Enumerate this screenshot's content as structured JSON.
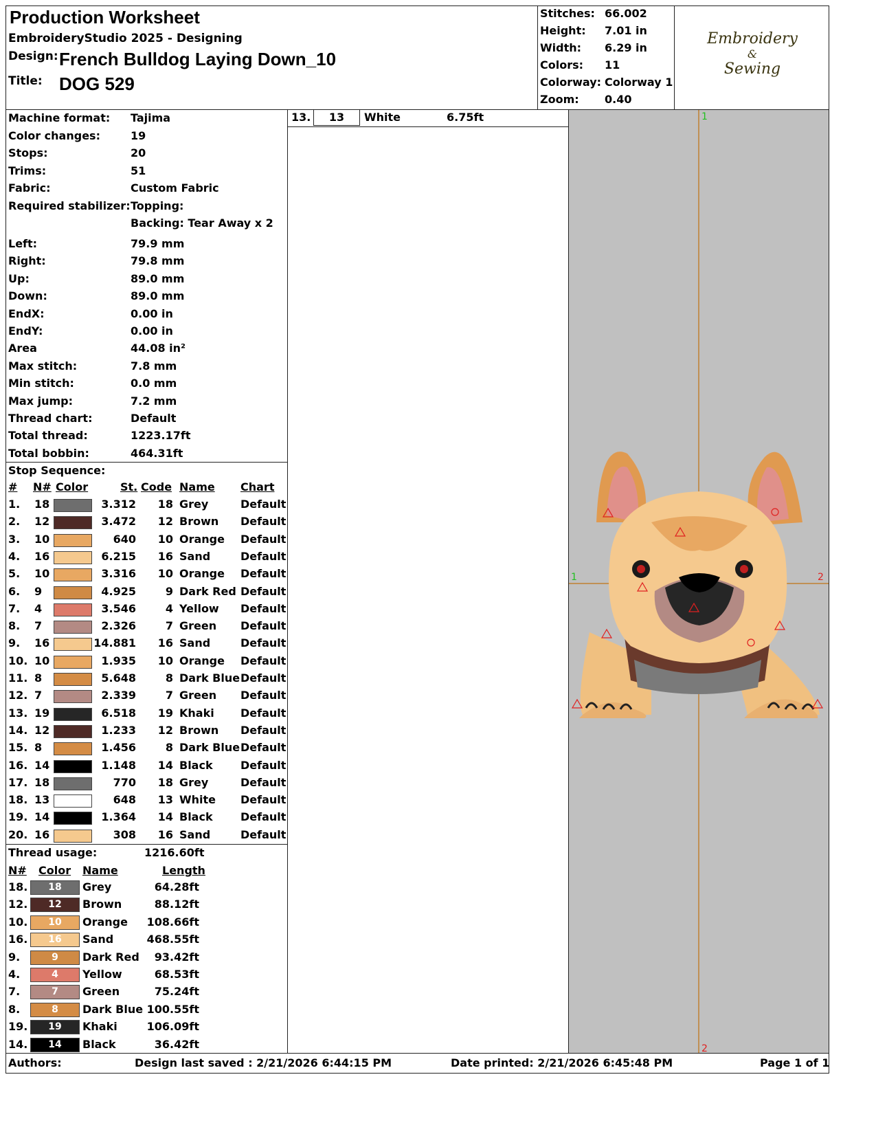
{
  "header": {
    "title": "Production Worksheet",
    "software": "EmbroideryStudio 2025 - Designing",
    "design_label": "Design:",
    "design_value": "French Bulldog Laying Down_10",
    "title_label": "Title:",
    "title_value": "DOG 529"
  },
  "summary": [
    {
      "label": "Stitches:",
      "value": "66.002"
    },
    {
      "label": "Height:",
      "value": "7.01 in"
    },
    {
      "label": "Width:",
      "value": "6.29 in"
    },
    {
      "label": "Colors:",
      "value": "11"
    },
    {
      "label": "Colorway:",
      "value": "Colorway 1"
    },
    {
      "label": "Zoom:",
      "value": "0.40"
    }
  ],
  "logo": {
    "line1": "Embroidery",
    "line2": "&",
    "line3": "Sewing"
  },
  "details": [
    {
      "label": "Machine format:",
      "value": "Tajima"
    },
    {
      "label": "Color changes:",
      "value": "19"
    },
    {
      "label": "Stops:",
      "value": "20"
    },
    {
      "label": "Trims:",
      "value": "51"
    },
    {
      "label": "Fabric:",
      "value": "Custom Fabric"
    },
    {
      "label": "Required stabilizer:",
      "value": "Topping:"
    },
    {
      "label": "",
      "value": "Backing: Tear Away x 2"
    }
  ],
  "extents": [
    {
      "label": "Left:",
      "value": "79.9 mm"
    },
    {
      "label": "Right:",
      "value": "79.8 mm"
    },
    {
      "label": "Up:",
      "value": "89.0 mm"
    },
    {
      "label": "Down:",
      "value": "89.0 mm"
    },
    {
      "label": "EndX:",
      "value": "0.00 in"
    },
    {
      "label": "EndY:",
      "value": "0.00 in"
    },
    {
      "label": "Area",
      "value": " 44.08 in²"
    },
    {
      "label": "Max stitch:",
      "value": "7.8 mm"
    },
    {
      "label": "Min stitch:",
      "value": "0.0 mm"
    },
    {
      "label": "Max jump:",
      "value": "7.2 mm"
    },
    {
      "label": "Thread chart:",
      "value": "Default"
    },
    {
      "label": "Total thread:",
      "value": "1223.17ft"
    },
    {
      "label": "Total bobbin:",
      "value": "464.31ft"
    }
  ],
  "stop_sequence": {
    "title": "Stop Sequence:",
    "headers": {
      "num": "#",
      "n": "N#",
      "color": "Color",
      "st": "St.",
      "code": "Code",
      "name": "Name",
      "chart": "Chart"
    },
    "rows": [
      {
        "num": "1.",
        "n": "18",
        "color": "#6e6e6e",
        "st": "3.312",
        "code": "18",
        "name": "Grey",
        "chart": "Default"
      },
      {
        "num": "2.",
        "n": "12",
        "color": "#4e2a26",
        "st": "3.472",
        "code": "12",
        "name": "Brown",
        "chart": "Default"
      },
      {
        "num": "3.",
        "n": "10",
        "color": "#e8a862",
        "st": "640",
        "code": "10",
        "name": "Orange",
        "chart": "Default"
      },
      {
        "num": "4.",
        "n": "16",
        "color": "#f5c98e",
        "st": "6.215",
        "code": "16",
        "name": "Sand",
        "chart": "Default"
      },
      {
        "num": "5.",
        "n": "10",
        "color": "#e8a862",
        "st": "3.316",
        "code": "10",
        "name": "Orange",
        "chart": "Default"
      },
      {
        "num": "6.",
        "n": "9",
        "color": "#cf8a45",
        "st": "4.925",
        "code": "9",
        "name": "Dark Red",
        "chart": "Default"
      },
      {
        "num": "7.",
        "n": "4",
        "color": "#dd7a6a",
        "st": "3.546",
        "code": "4",
        "name": "Yellow",
        "chart": "Default"
      },
      {
        "num": "8.",
        "n": "7",
        "color": "#b38a84",
        "st": "2.326",
        "code": "7",
        "name": "Green",
        "chart": "Default"
      },
      {
        "num": "9.",
        "n": "16",
        "color": "#f5c98e",
        "st": "14.881",
        "code": "16",
        "name": "Sand",
        "chart": "Default"
      },
      {
        "num": "10.",
        "n": "10",
        "color": "#e8a862",
        "st": "1.935",
        "code": "10",
        "name": "Orange",
        "chart": "Default"
      },
      {
        "num": "11.",
        "n": "8",
        "color": "#d48c45",
        "st": "5.648",
        "code": "8",
        "name": "Dark Blue",
        "chart": "Default"
      },
      {
        "num": "12.",
        "n": "7",
        "color": "#b38a84",
        "st": "2.339",
        "code": "7",
        "name": "Green",
        "chart": "Default"
      },
      {
        "num": "13.",
        "n": "19",
        "color": "#262626",
        "st": "6.518",
        "code": "19",
        "name": "Khaki",
        "chart": "Default"
      },
      {
        "num": "14.",
        "n": "12",
        "color": "#4e2a26",
        "st": "1.233",
        "code": "12",
        "name": "Brown",
        "chart": "Default"
      },
      {
        "num": "15.",
        "n": "8",
        "color": "#d48c45",
        "st": "1.456",
        "code": "8",
        "name": "Dark Blue",
        "chart": "Default"
      },
      {
        "num": "16.",
        "n": "14",
        "color": "#000000",
        "st": "1.148",
        "code": "14",
        "name": "Black",
        "chart": "Default"
      },
      {
        "num": "17.",
        "n": "18",
        "color": "#6e6e6e",
        "st": "770",
        "code": "18",
        "name": "Grey",
        "chart": "Default"
      },
      {
        "num": "18.",
        "n": "13",
        "color": "#ffffff",
        "st": "648",
        "code": "13",
        "name": "White",
        "chart": "Default"
      },
      {
        "num": "19.",
        "n": "14",
        "color": "#000000",
        "st": "1.364",
        "code": "14",
        "name": "Black",
        "chart": "Default"
      },
      {
        "num": "20.",
        "n": "16",
        "color": "#f5c98e",
        "st": "308",
        "code": "16",
        "name": "Sand",
        "chart": "Default"
      }
    ]
  },
  "thread_usage": {
    "label": "Thread usage:",
    "total": "1216.60ft",
    "headers": {
      "n": "N#",
      "color": "Color",
      "name": "Name",
      "length": "Length"
    },
    "rows": [
      {
        "n": "18.",
        "code": "18",
        "color": "#6e6e6e",
        "name": "Grey",
        "length": "64.28ft"
      },
      {
        "n": "12.",
        "code": "12",
        "color": "#4e2a26",
        "name": "Brown",
        "length": "88.12ft"
      },
      {
        "n": "10.",
        "code": "10",
        "color": "#e8a862",
        "name": "Orange",
        "length": "108.66ft"
      },
      {
        "n": "16.",
        "code": "16",
        "color": "#f5c98e",
        "name": "Sand",
        "length": "468.55ft"
      },
      {
        "n": "9.",
        "code": "9",
        "color": "#cf8a45",
        "name": "Dark Red",
        "length": "93.42ft"
      },
      {
        "n": "4.",
        "code": "4",
        "color": "#dd7a6a",
        "name": "Yellow",
        "length": "68.53ft"
      },
      {
        "n": "7.",
        "code": "7",
        "color": "#b38a84",
        "name": "Green",
        "length": "75.24ft"
      },
      {
        "n": "8.",
        "code": "8",
        "color": "#d48c45",
        "name": "Dark Blue",
        "length": "100.55ft"
      },
      {
        "n": "19.",
        "code": "19",
        "color": "#262626",
        "name": "Khaki",
        "length": "106.09ft"
      },
      {
        "n": "14.",
        "code": "14",
        "color": "#000000",
        "name": "Black",
        "length": "36.42ft"
      }
    ]
  },
  "middle_row": {
    "num": "13.",
    "code": "13",
    "name": "White",
    "length": "6.75ft"
  },
  "preview": {
    "marker1": "1",
    "marker2": "2"
  },
  "footer": {
    "authors": "Authors:",
    "saved": "Design last saved : 2/21/2026 6:44:15 PM",
    "printed": "Date printed: 2/21/2026 6:45:48 PM",
    "page": "Page 1 of 1"
  }
}
